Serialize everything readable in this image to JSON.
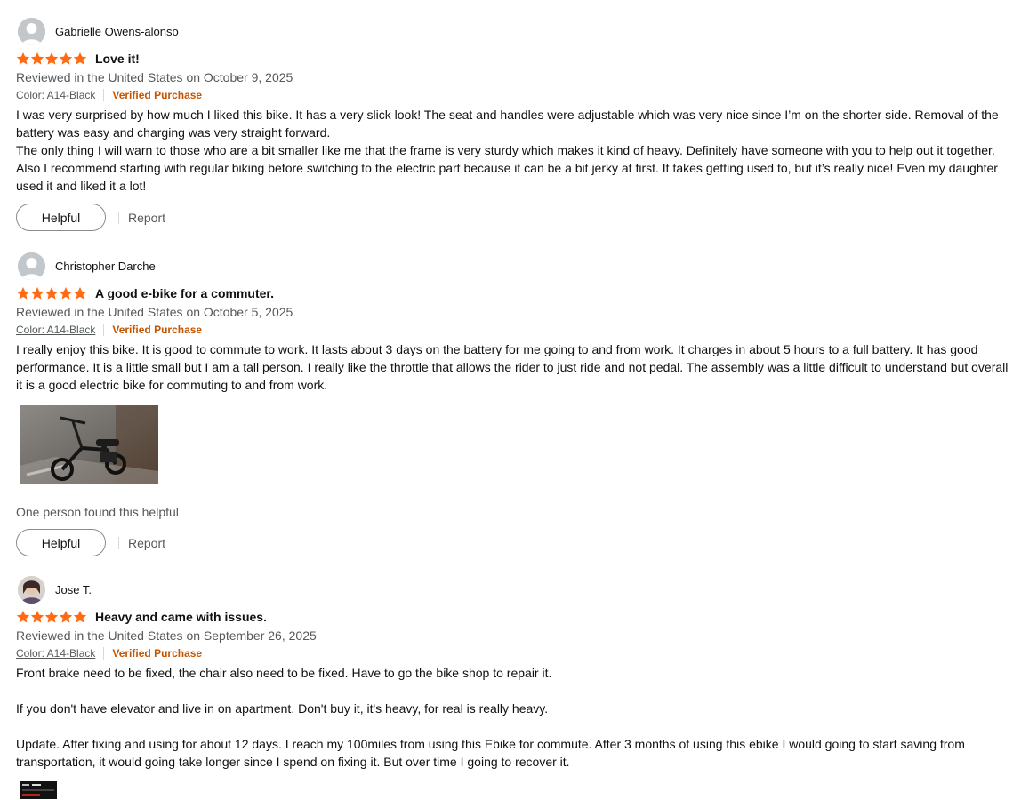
{
  "colors": {
    "star": "#ff6a13",
    "verified": "#c45500",
    "secondary_text": "#565959",
    "primary_text": "#0f1111"
  },
  "icons": {
    "avatar_default": "default-person-avatar-icon",
    "star": "star-filled-icon"
  },
  "reviews": [
    {
      "author": "Gabrielle Owens-alonso",
      "rating": 5,
      "title": "Love it!",
      "date": "Reviewed in the United States on October 9, 2025",
      "color": "Color: A14-Black",
      "verified": "Verified Purchase",
      "body": [
        "I was very surprised by how much I liked this bike. It has a very slick look! The seat and handles were adjustable which was very nice since I’m on the shorter side. Removal of the battery was easy and charging was very straight forward.",
        "The only thing I will warn to those who are a bit smaller like me that the frame is very sturdy which makes it kind of heavy. Definitely have someone with you to help out it together. Also I recommend starting with regular biking before switching to the electric part because it can be a bit jerky at first. It takes getting used to, but it’s really nice! Even my daughter used it and liked it a lot!"
      ],
      "helpful_label": "Helpful",
      "report_label": "Report"
    },
    {
      "author": "Christopher Darche",
      "rating": 5,
      "title": "A good e-bike for a commuter.",
      "date": "Reviewed in the United States on October 5, 2025",
      "color": "Color: A14-Black",
      "verified": "Verified Purchase",
      "body": [
        "I really enjoy this bike. It is good to commute to work. It lasts about 3 days on the battery for me going to and from work. It charges in about 5 hours to a full battery. It has good performance. It is a little small but I am a tall person. I really like the throttle that allows the rider to just ride and not pedal. The assembly was a little difficult to understand but overall it is a good electric bike for commuting to and from work."
      ],
      "helpful_count": "One person found this helpful",
      "helpful_label": "Helpful",
      "report_label": "Report"
    },
    {
      "author": "Jose T.",
      "rating": 5,
      "title": "Heavy and came with issues.",
      "date": "Reviewed in the United States on September 26, 2025",
      "color": "Color: A14-Black",
      "verified": "Verified Purchase",
      "body": [
        "Front brake need to be fixed, the chair also need to be fixed. Have to go the bike shop to repair it.",
        "If you don't have elevator and live in on apartment. Don't buy it, it's heavy, for real is really heavy.",
        "Update. After fixing and using for about 12 days. I reach my 100miles from using this Ebike for commute. After 3 months of using this ebike I would going to start saving from transportation, it would going take longer since I spend on fixing it. But over time I going to recover it."
      ]
    }
  ]
}
